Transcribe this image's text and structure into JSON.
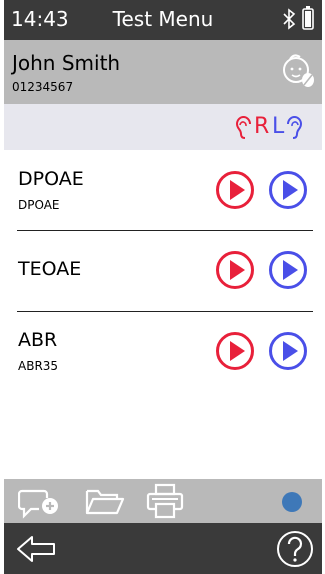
{
  "status": {
    "time": "14:43",
    "title": "Test Menu"
  },
  "patient": {
    "name": "John Smith",
    "id": "01234567"
  },
  "ears": {
    "right_label": "R",
    "left_label": "L",
    "right_color": "#e8203a",
    "left_color": "#4a4fe8"
  },
  "tests": [
    {
      "name": "DPOAE",
      "subtitle": "DPOAE"
    },
    {
      "name": "TEOAE",
      "subtitle": ""
    },
    {
      "name": "ABR",
      "subtitle": "ABR35"
    }
  ],
  "icons": {
    "status": [
      "bluetooth-icon",
      "battery-icon"
    ],
    "patient": "baby-profile-icon",
    "toolbar": [
      "add-comment-icon",
      "folder-icon",
      "printer-icon",
      "status-indicator-dot"
    ],
    "nav": [
      "back-arrow-icon",
      "help-icon"
    ]
  },
  "colors": {
    "right_play": "#e8203a",
    "left_play": "#4a4fe8",
    "indicator": "#3e78b8"
  }
}
